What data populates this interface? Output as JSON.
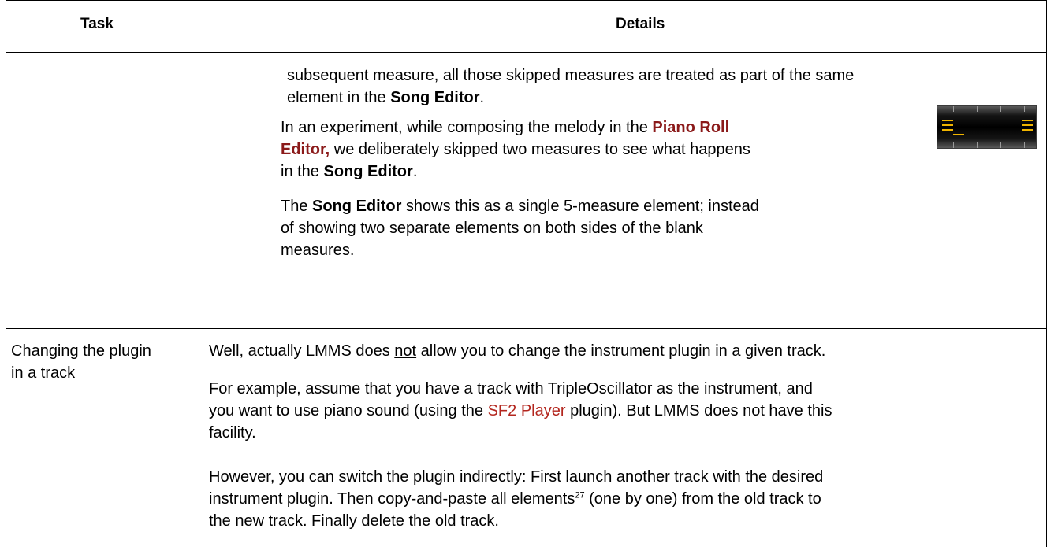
{
  "table": {
    "headers": {
      "task": "Task",
      "details": "Details"
    },
    "row1": {
      "task": "",
      "p1_line1": "subsequent measure, all those skipped measures are treated as part of the same",
      "p1_line2_pre": "element in the ",
      "p1_line2_bold": "Song Editor",
      "p1_line2_post": ".",
      "p2_line1_pre": "In an experiment, while composing the melody in the ",
      "p2_line1_red": "Piano Roll",
      "p2_line2_red": "Editor,",
      "p2_line2_post": " we deliberately skipped two measures to see what happens",
      "p2_line3_pre": "in the ",
      "p2_line3_bold": "Song Editor",
      "p2_line3_post": ".",
      "p3_line1_pre": "The ",
      "p3_line1_bold": "Song Editor",
      "p3_line1_post": " shows this as a single 5-measure element; instead",
      "p3_line2": "of showing two separate elements on both sides of the blank",
      "p3_line3": "measures.",
      "thumbnail": "song-editor-element-thumbnail"
    },
    "row2": {
      "task_line1": "Changing the plugin",
      "task_line2": "in a track",
      "p1_pre": "Well, actually LMMS does ",
      "p1_u": "not",
      "p1_post": " allow you to change the instrument plugin in a given track.",
      "p2_line1": "For example, assume that you have a track with TripleOscillator as the instrument, and",
      "p2_line2_pre": "you want to use piano sound (using the ",
      "p2_line2_link": "SF2 Player",
      "p2_line2_post": " plugin). But LMMS does not have this",
      "p2_line3": "facility.",
      "p3_line1": "However, you can switch the plugin indirectly: First launch another track with the desired",
      "p3_line2_pre": "instrument plugin. Then copy-and-paste all elements",
      "p3_line2_sup": "27",
      "p3_line2_post": " (one by one) from the old track to",
      "p3_line3": "the new track. Finally delete the old track."
    }
  }
}
